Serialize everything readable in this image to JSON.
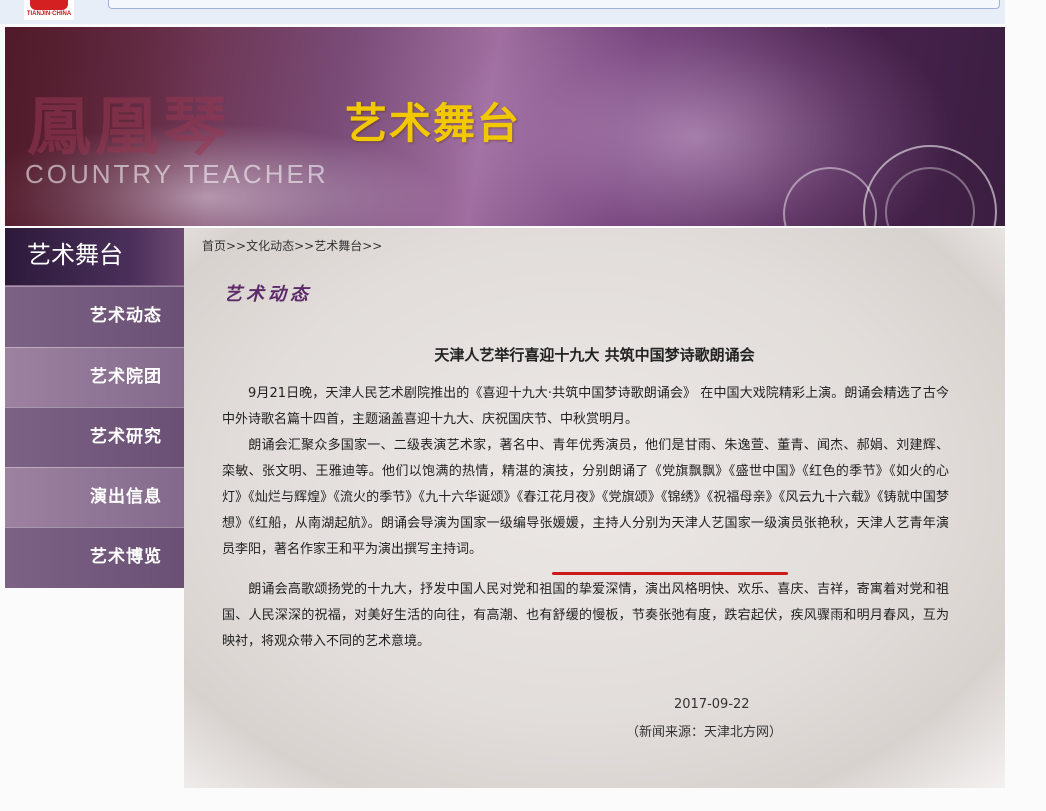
{
  "header": {
    "logo_text": "TIANJIN·CHINA"
  },
  "banner": {
    "calligraphy": "鳳凰琴",
    "ghost_text": "COUNTRY TEACHER",
    "title": "艺术舞台"
  },
  "sidebar": {
    "title": "艺术舞台",
    "items": [
      {
        "label": "艺术动态"
      },
      {
        "label": "艺术院团"
      },
      {
        "label": "艺术研究"
      },
      {
        "label": "演出信息"
      },
      {
        "label": "艺术博览"
      }
    ]
  },
  "breadcrumb": "首页>>文化动态>>艺术舞台>>",
  "section_title": "艺术动态",
  "article": {
    "title": "天津人艺举行喜迎十九大 共筑中国梦诗歌朗诵会",
    "paragraphs": [
      "9月21日晚，天津人民艺术剧院推出的《喜迎十九大·共筑中国梦诗歌朗诵会》 在中国大戏院精彩上演。朗诵会精选了古今中外诗歌名篇十四首，主题涵盖喜迎十九大、庆祝国庆节、中秋赏明月。",
      "朗诵会汇聚众多国家一、二级表演艺术家，著名中、青年优秀演员，他们是甘雨、朱逸萱、董青、闻杰、郝娟、刘建辉、栾敏、张文明、王雅迪等。他们以饱满的热情，精湛的演技，分别朗诵了《党旗飘飘》《盛世中国》《红色的季节》《如火的心灯》《灿烂与辉煌》《流火的季节》《九十六华诞颂》《春江花月夜》《党旗颂》《锦绣》《祝福母亲》《风云九十六载》《铸就中国梦想》《红船，从南湖起航》。朗诵会导演为国家一级编导张媛媛，主持人分别为天津人艺国家一级演员张艳秋，天津人艺青年演员李阳，著名作家王和平为演出撰写主持词。",
      "朗诵会高歌颂扬党的十九大，抒发中国人民对党和祖国的挚爱深情，演出风格明快、欢乐、喜庆、吉祥，寄寓着对党和祖国、人民深深的祝福，对美好生活的向往，有高潮、也有舒缓的慢板，节奏张弛有度，跌宕起伏，疾风骤雨和明月春风，互为映衬，将观众带入不同的艺术意境。"
    ],
    "date": "2017-09-22",
    "source": "（新闻来源：天津北方网）"
  },
  "colors": {
    "banner_title": "#f2c800",
    "section_title": "#5c2a6a",
    "underline": "#cc1a1a"
  }
}
